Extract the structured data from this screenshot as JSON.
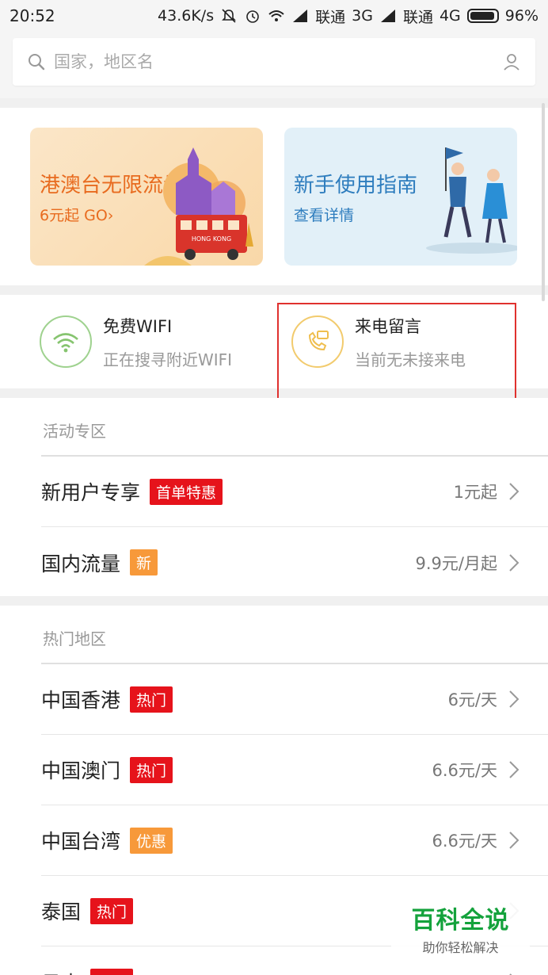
{
  "status_bar": {
    "time": "20:52",
    "speed": "43.6K/s",
    "carrier1": "联通",
    "network1": "3G",
    "carrier2": "联通",
    "network2": "4G",
    "battery": "96%",
    "battery_level": 0.96
  },
  "search": {
    "placeholder": "国家，地区名",
    "search_icon": "search-icon",
    "user_icon": "user-icon"
  },
  "banners": [
    {
      "title": "港澳台无限流量",
      "subtitle": "6元起 GO›",
      "art_sign": "HONG KONG"
    },
    {
      "title": "新手使用指南",
      "subtitle": "查看详情"
    }
  ],
  "services": [
    {
      "title": "免费WIFI",
      "subtitle": "正在搜寻附近WIFI",
      "icon": "wifi-icon"
    },
    {
      "title": "来电留言",
      "subtitle": "当前无未接来电",
      "icon": "phone-message-icon"
    }
  ],
  "activity": {
    "title": "活动专区",
    "rows": [
      {
        "label": "新用户专享",
        "tag": "首单特惠",
        "tag_color": "#e6131b",
        "value": "1元起"
      },
      {
        "label": "国内流量",
        "tag": "新",
        "tag_color": "#f7993a",
        "value": "9.9元/月起"
      }
    ]
  },
  "hot": {
    "title": "热门地区",
    "rows": [
      {
        "label": "中国香港",
        "tag": "热门",
        "tag_color": "#e6131b",
        "value": "6元/天"
      },
      {
        "label": "中国澳门",
        "tag": "热门",
        "tag_color": "#e6131b",
        "value": "6.6元/天"
      },
      {
        "label": "中国台湾",
        "tag": "优惠",
        "tag_color": "#f7993a",
        "value": "6.6元/天"
      },
      {
        "label": "泰国",
        "tag": "热门",
        "tag_color": "#e6131b",
        "value": ""
      },
      {
        "label": "日本",
        "tag": "热门",
        "tag_color": "#e6131b",
        "value": ""
      }
    ]
  },
  "watermark": {
    "title": "百科全说",
    "subtitle": "助你轻松解决"
  },
  "colors": {
    "accent_red": "#e6131b",
    "accent_orange": "#f7993a",
    "highlight_border": "#e0312e",
    "watermark_green": "#14a23c"
  }
}
